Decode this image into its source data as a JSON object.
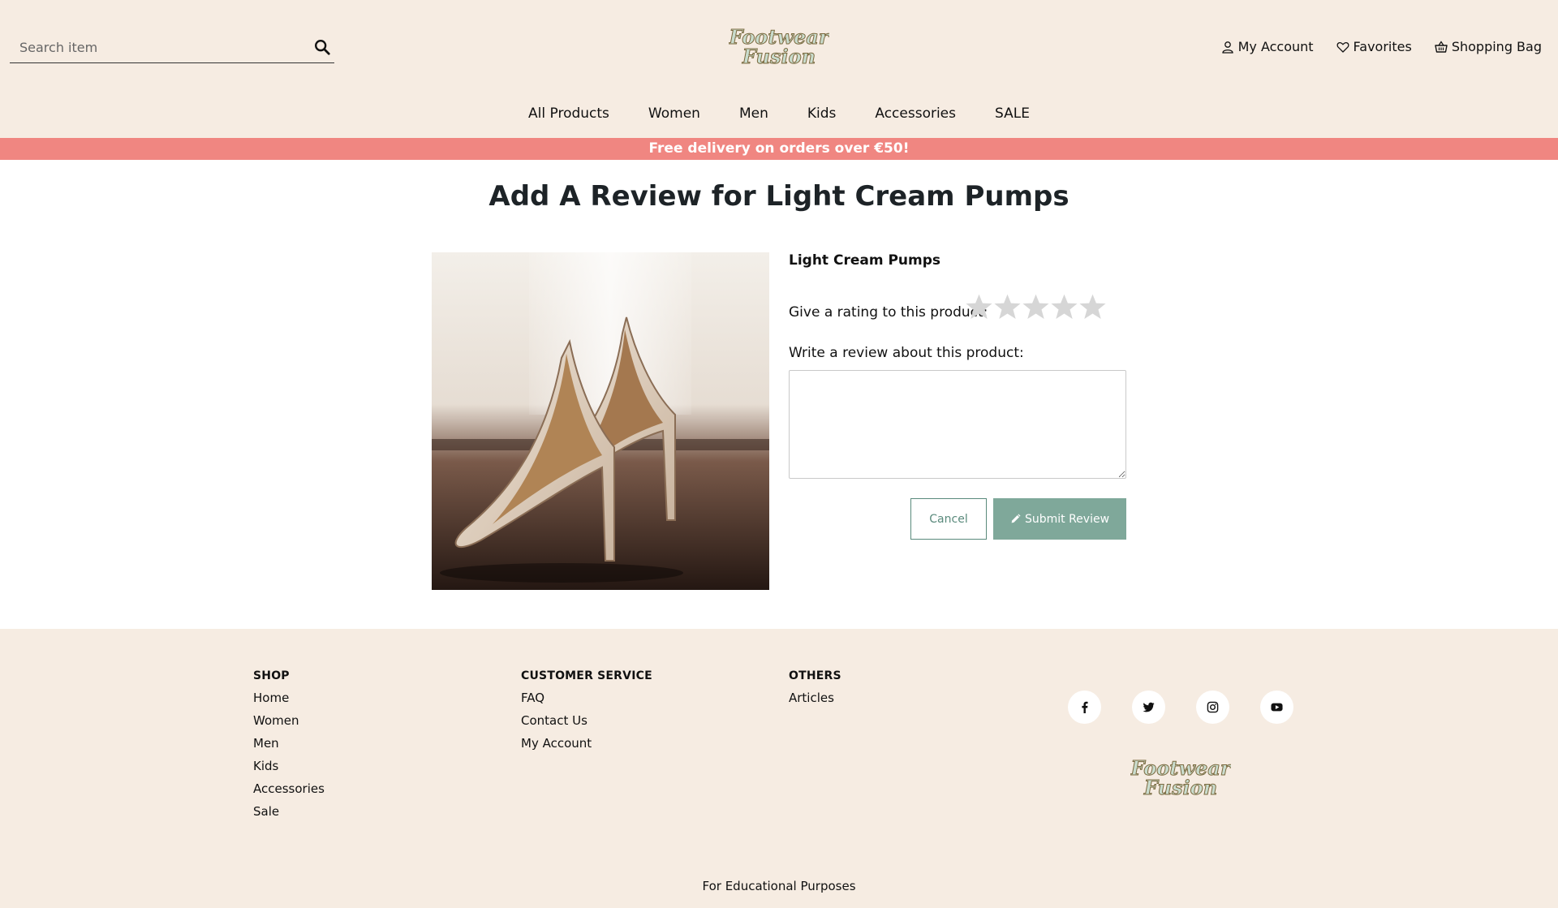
{
  "search": {
    "placeholder": "Search item"
  },
  "brand": {
    "name": "Footwear Fusion",
    "line1": "Footwear",
    "line2": "Fusion"
  },
  "header_links": [
    {
      "label": "My Account",
      "icon": "user-icon"
    },
    {
      "label": "Favorites",
      "icon": "heart-icon"
    },
    {
      "label": "Shopping Bag",
      "icon": "basket-icon"
    }
  ],
  "nav": [
    "All Products",
    "Women",
    "Men",
    "Kids",
    "Accessories",
    "SALE"
  ],
  "banner": "Free delivery on orders over €50!",
  "page_title": "Add A Review for Light Cream Pumps",
  "product": {
    "name": "Light Cream Pumps",
    "image": "cream-pumps-photo"
  },
  "form": {
    "rating_label": "Give a rating to this product:",
    "rating_value": 0,
    "rating_max": 5,
    "review_label": "Write a review about this product:",
    "review_value": "",
    "cancel_label": "Cancel",
    "submit_label": "Submit Review"
  },
  "footer": {
    "shop": {
      "title": "SHOP",
      "links": [
        "Home",
        "Women",
        "Men",
        "Kids",
        "Accessories",
        "Sale"
      ]
    },
    "customer_service": {
      "title": "CUSTOMER SERVICE",
      "links": [
        "FAQ",
        "Contact Us",
        "My Account"
      ]
    },
    "others": {
      "title": "OTHERS",
      "links": [
        "Articles"
      ]
    },
    "socials": [
      "facebook-icon",
      "twitter-icon",
      "instagram-icon",
      "youtube-icon"
    ],
    "note": "For Educational Purposes"
  },
  "colors": {
    "header_bg": "#f6ece2",
    "banner_bg": "#f08681",
    "accent": "#7fa89a",
    "star_empty": "#d6d6d6"
  }
}
